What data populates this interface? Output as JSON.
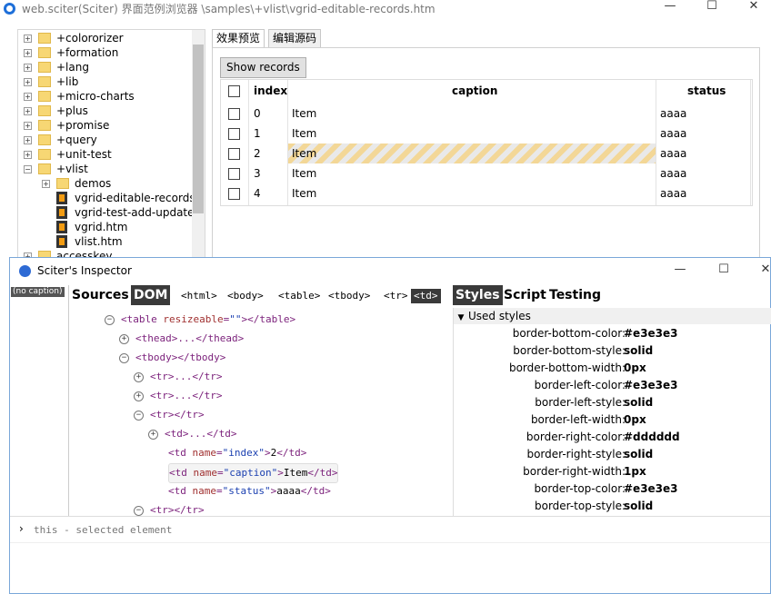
{
  "window": {
    "title": "web.sciter(Sciter) 界面范例浏览器 \\samples\\+vlist\\vgrid-editable-records.htm",
    "min": "—",
    "max": "☐",
    "close": "✕"
  },
  "tree": {
    "items": [
      {
        "label": "+colororizer",
        "exp": "+",
        "type": "folder"
      },
      {
        "label": "+formation",
        "exp": "+",
        "type": "folder"
      },
      {
        "label": "+lang",
        "exp": "+",
        "type": "folder"
      },
      {
        "label": "+lib",
        "exp": "+",
        "type": "folder"
      },
      {
        "label": "+micro-charts",
        "exp": "+",
        "type": "folder"
      },
      {
        "label": "+plus",
        "exp": "+",
        "type": "folder"
      },
      {
        "label": "+promise",
        "exp": "+",
        "type": "folder"
      },
      {
        "label": "+query",
        "exp": "+",
        "type": "folder"
      },
      {
        "label": "+unit-test",
        "exp": "+",
        "type": "folder"
      },
      {
        "label": "+vlist",
        "exp": "−",
        "type": "folder"
      },
      {
        "label": "demos",
        "exp": "+",
        "type": "folder",
        "indent": 1
      },
      {
        "label": "vgrid-editable-records.h",
        "type": "file",
        "indent": 1
      },
      {
        "label": "vgrid-test-add-update.h",
        "type": "file",
        "indent": 1
      },
      {
        "label": "vgrid.htm",
        "type": "file",
        "indent": 1
      },
      {
        "label": "vlist.htm",
        "type": "file",
        "indent": 1
      },
      {
        "label": "accesskey",
        "exp": "+",
        "type": "folder"
      }
    ]
  },
  "tabs": [
    {
      "label": "效果预览"
    },
    {
      "label": "编辑源码"
    }
  ],
  "preview": {
    "show_button": "Show records",
    "columns": {
      "index": "index",
      "caption": "caption",
      "status": "status"
    },
    "rows": [
      {
        "index": "0",
        "caption": "Item",
        "status": "aaaa"
      },
      {
        "index": "1",
        "caption": "Item",
        "status": "aaaa"
      },
      {
        "index": "2",
        "caption": "Item",
        "status": "aaaa",
        "selected": true
      },
      {
        "index": "3",
        "caption": "Item",
        "status": "aaaa"
      },
      {
        "index": "4",
        "caption": "Item",
        "status": "aaaa"
      }
    ]
  },
  "inspector": {
    "title": "Sciter's Inspector",
    "min": "—",
    "max": "☐",
    "close": "✕",
    "no_caption": "(no caption)",
    "toolbar": {
      "sources": "Sources",
      "dom": "DOM"
    },
    "breadcrumb": [
      "<html>",
      "<body>",
      "<table>",
      "<tbody>",
      "<tr>",
      "<td>"
    ],
    "styles_tabs": {
      "styles": "Styles",
      "script": "Script",
      "testing": "Testing"
    },
    "used_styles": "Used styles",
    "dom_lines": [
      {
        "exp": "−",
        "parts": [
          [
            "t",
            "<table "
          ],
          [
            "an",
            "resizeable"
          ],
          [
            "t",
            "="
          ],
          [
            "av",
            "\"\""
          ],
          [
            "t",
            "></table>"
          ]
        ]
      },
      {
        "exp": "+",
        "parts": [
          [
            "t",
            "<thead>...</thead>"
          ]
        ]
      },
      {
        "exp": "−",
        "parts": [
          [
            "t",
            "<tbody></tbody>"
          ]
        ]
      },
      {
        "exp": "+",
        "parts": [
          [
            "t",
            "<tr>...</tr>"
          ]
        ]
      },
      {
        "exp": "+",
        "parts": [
          [
            "t",
            "<tr>...</tr>"
          ]
        ]
      },
      {
        "exp": "−",
        "parts": [
          [
            "t",
            "<tr></tr>"
          ]
        ]
      },
      {
        "exp": "+",
        "parts": [
          [
            "t",
            "<td>...</td>"
          ]
        ]
      },
      {
        "exp": "",
        "parts": [
          [
            "t",
            "<td "
          ],
          [
            "an",
            "name"
          ],
          [
            "t",
            "="
          ],
          [
            "av",
            "\"index\""
          ],
          [
            "t",
            ">"
          ],
          [
            "tx",
            "2"
          ],
          [
            "t",
            "</td>"
          ]
        ]
      },
      {
        "exp": "",
        "selected": true,
        "parts": [
          [
            "t",
            "<td "
          ],
          [
            "an",
            "name"
          ],
          [
            "t",
            "="
          ],
          [
            "av",
            "\"caption\""
          ],
          [
            "t",
            ">"
          ],
          [
            "tx",
            "Item"
          ],
          [
            "t",
            "</td>"
          ]
        ]
      },
      {
        "exp": "",
        "parts": [
          [
            "t",
            "<td "
          ],
          [
            "an",
            "name"
          ],
          [
            "t",
            "="
          ],
          [
            "av",
            "\"status\""
          ],
          [
            "t",
            ">"
          ],
          [
            "tx",
            "aaaa"
          ],
          [
            "t",
            "</td>"
          ]
        ]
      },
      {
        "exp": "−",
        "parts": [
          [
            "t",
            "<tr></tr>"
          ]
        ]
      }
    ],
    "styles": [
      {
        "prop": "border-bottom-color:",
        "val": "#e3e3e3"
      },
      {
        "prop": "border-bottom-style:",
        "val": "solid"
      },
      {
        "prop": "border-bottom-width:",
        "val": "0px"
      },
      {
        "prop": "border-left-color:",
        "val": "#e3e3e3"
      },
      {
        "prop": "border-left-style:",
        "val": "solid"
      },
      {
        "prop": "border-left-width:",
        "val": "0px"
      },
      {
        "prop": "border-right-color:",
        "val": "#dddddd"
      },
      {
        "prop": "border-right-style:",
        "val": "solid"
      },
      {
        "prop": "border-right-width:",
        "val": "1px"
      },
      {
        "prop": "border-top-color:",
        "val": "#e3e3e3"
      },
      {
        "prop": "border-top-style:",
        "val": "solid"
      }
    ],
    "console": {
      "prompt": "›",
      "placeholder": "this - selected element"
    }
  }
}
